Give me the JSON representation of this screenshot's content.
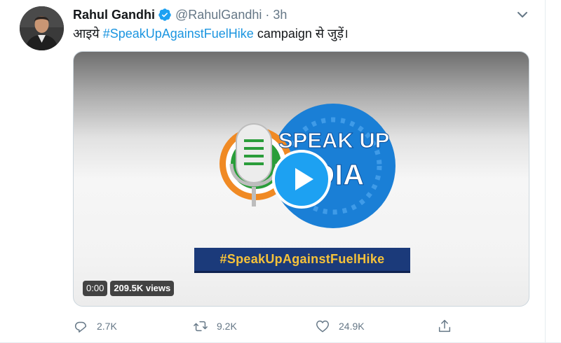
{
  "author": {
    "display_name": "Rahul Gandhi",
    "handle": "@RahulGandhi",
    "separator": "·",
    "time": "3h",
    "verified_color": "#1da1f2"
  },
  "tweet": {
    "text_prefix": "आइये ",
    "hashtag": "#SpeakUpAgainstFuelHike",
    "text_suffix": " campaign से जुड़ें।"
  },
  "media": {
    "logo_line1": "SPEAK UP",
    "logo_line2": "INDIA",
    "banner": "#SpeakUpAgainstFuelHike",
    "time_badge": "0:00",
    "views_badge": "209.5K views",
    "accent_blue": "#1a7fd6",
    "banner_text_color": "#f6c23a"
  },
  "actions": {
    "reply": {
      "icon": "reply-icon",
      "count": "2.7K"
    },
    "retweet": {
      "icon": "retweet-icon",
      "count": "9.2K"
    },
    "like": {
      "icon": "heart-icon",
      "count": "24.9K"
    },
    "share": {
      "icon": "share-icon"
    }
  }
}
